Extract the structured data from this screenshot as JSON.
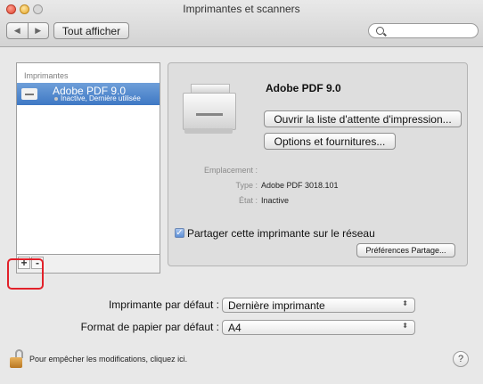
{
  "window": {
    "title": "Imprimantes et scanners",
    "show_all": "Tout afficher",
    "search_placeholder": ""
  },
  "printers_list": {
    "header": "Imprimantes",
    "items": [
      {
        "name": "Adobe PDF 9.0",
        "status": "Inactive, Dernière utilisée"
      }
    ],
    "add_label": "+",
    "remove_label": "-"
  },
  "details": {
    "name": "Adobe PDF 9.0",
    "open_queue": "Ouvrir la liste d'attente d'impression...",
    "options": "Options et fournitures...",
    "location_label": "Emplacement :",
    "location_value": "",
    "type_label": "Type :",
    "type_value": "Adobe PDF 3018.101",
    "status_label": "État :",
    "status_value": "Inactive",
    "share_label": "Partager cette imprimante sur le réseau",
    "share_checked": true,
    "share_prefs": "Préférences Partage..."
  },
  "defaults": {
    "printer_label": "Imprimante par défaut :",
    "printer_value": "Dernière imprimante",
    "paper_label": "Format de papier par défaut :",
    "paper_value": "A4"
  },
  "footer": {
    "lock_text": "Pour empêcher les modifications, cliquez ici.",
    "help": "?"
  },
  "colors": {
    "selection": "#3e78c4",
    "highlight_box": "#e2212a"
  }
}
